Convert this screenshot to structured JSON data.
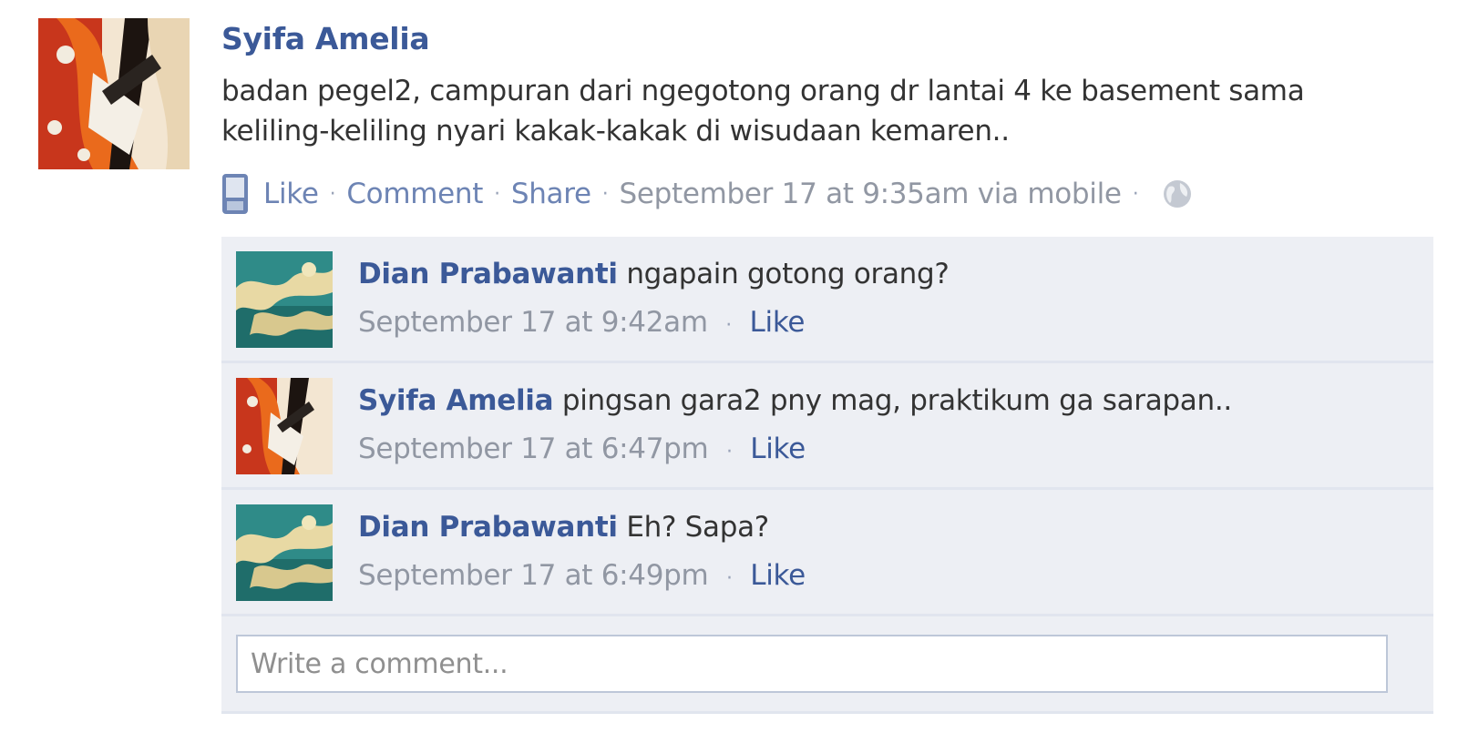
{
  "post": {
    "author": "Syifa Amelia",
    "text_line1": "badan pegel2, campuran dari ngegotong orang dr lantai 4 ke basement sama",
    "text_line2": "keliling-keliling nyari kakak-kakak di wisudaan kemaren..",
    "actions": {
      "like": "Like",
      "comment": "Comment",
      "share": "Share",
      "timestamp": "September 17 at 9:35am via mobile"
    },
    "separator": "·"
  },
  "comments": [
    {
      "author": "Dian Prabawanti",
      "text": "ngapain gotong orang?",
      "timestamp": "September 17 at 9:42am",
      "like": "Like"
    },
    {
      "author": "Syifa Amelia",
      "text": "pingsan gara2 pny mag, praktikum ga sarapan..",
      "timestamp": "September 17 at 6:47pm",
      "like": "Like"
    },
    {
      "author": "Dian Prabawanti",
      "text": "Eh? Sapa?",
      "timestamp": "September 17 at 6:49pm",
      "like": "Like"
    }
  ],
  "composer": {
    "placeholder": "Write a comment..."
  },
  "icons": {
    "mobile": "mobile-phone-icon",
    "privacy": "globe-icon"
  },
  "colors": {
    "link": "#3b5998",
    "link_light": "#6d84b4",
    "meta": "#9197a3",
    "comment_bg": "#edeff4"
  }
}
